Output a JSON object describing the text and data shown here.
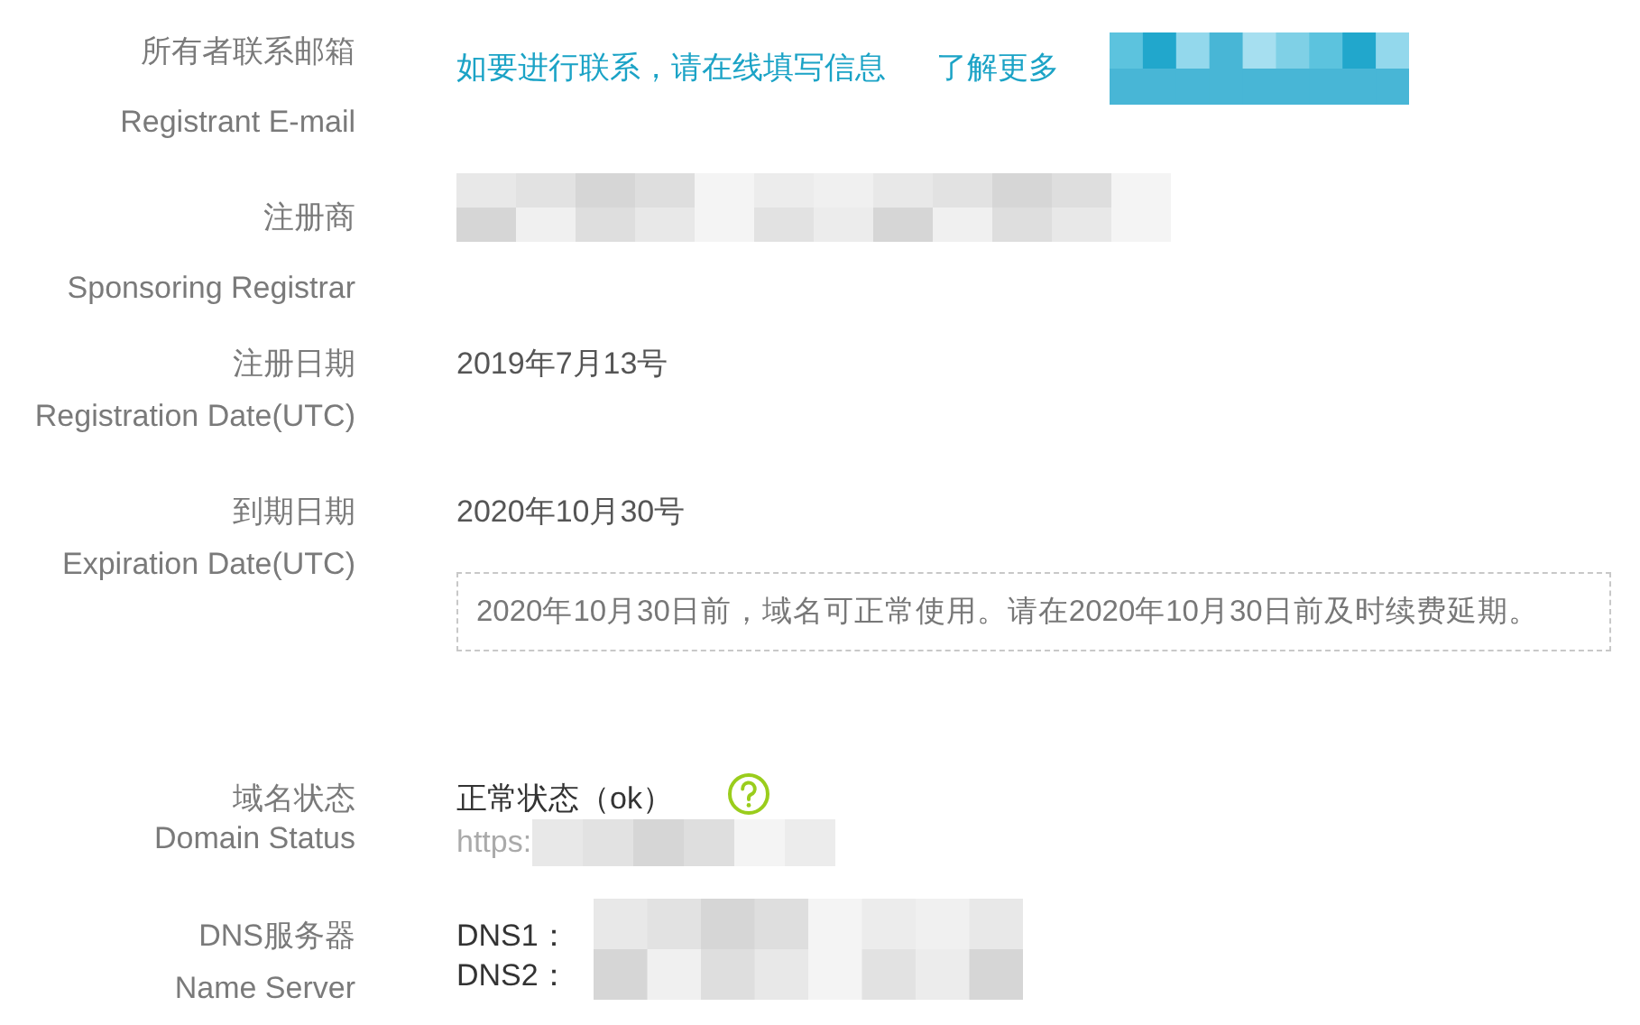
{
  "rows": [
    {
      "label_zh": "所有者联系邮箱",
      "label_en": "Registrant E-mail",
      "value": {
        "kind": "contact",
        "text": "如要进行联系，请在线填写信息",
        "link": "了解更多"
      }
    },
    {
      "label_zh": "注册商",
      "label_en": "Sponsoring Registrar",
      "value": {
        "kind": "redacted"
      }
    },
    {
      "label_zh": "注册日期",
      "label_en": "Registration Date(UTC)",
      "value": {
        "kind": "text",
        "text": "2019年7月13号"
      }
    },
    {
      "label_zh": "到期日期",
      "label_en": "Expiration Date(UTC)",
      "value": {
        "kind": "text",
        "text": "2020年10月30号",
        "note": "2020年10月30日前，域名可正常使用。请在2020年10月30日前及时续费延期。"
      }
    },
    {
      "label_zh": "域名状态",
      "label_en": "Domain Status",
      "value": {
        "kind": "status",
        "text": "正常状态（ok）",
        "url_prefix": "https:"
      }
    },
    {
      "label_zh": "DNS服务器",
      "label_en": "Name Server",
      "value": {
        "kind": "dns",
        "entries": [
          "DNS1：",
          "DNS2："
        ]
      }
    }
  ]
}
